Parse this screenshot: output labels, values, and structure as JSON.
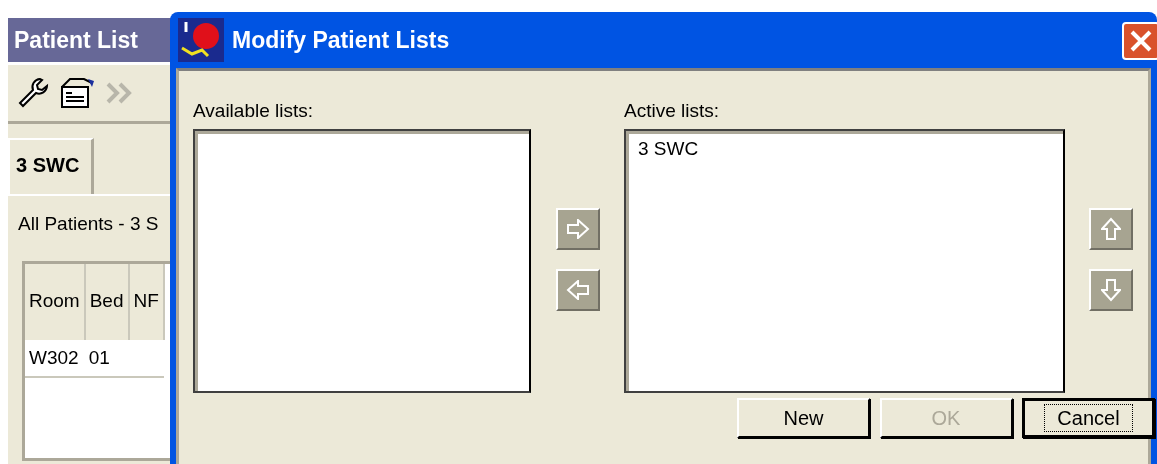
{
  "background_window": {
    "title": "Patient List",
    "tabs": [
      {
        "label": "3 SWC",
        "selected": true
      }
    ],
    "list_caption": "All Patients - 3 S",
    "table": {
      "columns": [
        "Room",
        "Bed",
        "NF"
      ],
      "rows": [
        [
          "W302",
          "01"
        ]
      ]
    }
  },
  "dialog": {
    "title": "Modify Patient Lists",
    "available": {
      "label": "Available lists:"
    },
    "active": {
      "label": "Active lists:",
      "items": [
        {
          "text": "3 SWC",
          "selected": false
        }
      ]
    },
    "buttons": [
      {
        "label": "New",
        "disabled": false,
        "default": false
      },
      {
        "label": "OK",
        "disabled": true,
        "default": false
      },
      {
        "label": "Cancel",
        "disabled": false,
        "default": true
      }
    ]
  }
}
